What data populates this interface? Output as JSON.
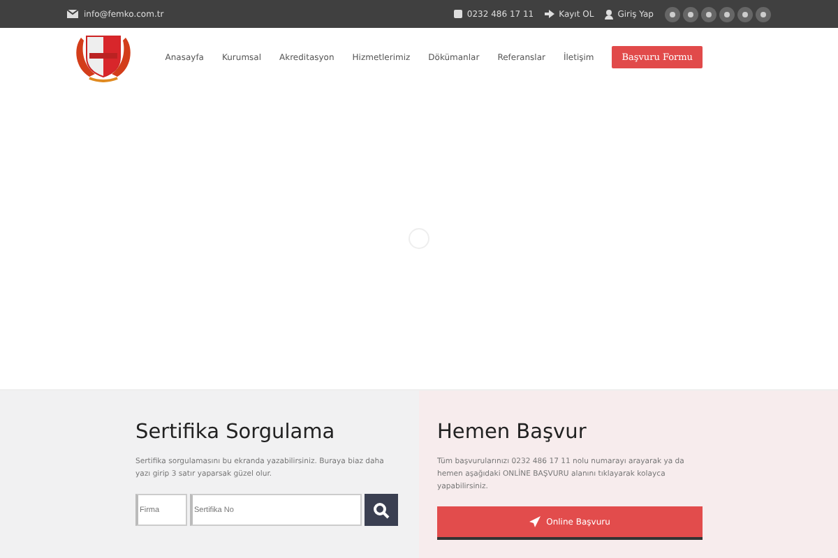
{
  "topbar": {
    "email": "info@femko.com.tr",
    "phone": "0232 486 17 11",
    "register": "Kayıt OL",
    "login": "Giriş Yap"
  },
  "nav": {
    "items": [
      {
        "label": "Anasayfa"
      },
      {
        "label": "Kurumsal"
      },
      {
        "label": "Akreditasyon"
      },
      {
        "label": "Hizmetlerimiz"
      },
      {
        "label": "Dökümanlar"
      },
      {
        "label": "Referanslar"
      },
      {
        "label": "İletişim"
      }
    ],
    "cta": "Başvuru Formu"
  },
  "certificate": {
    "title": "Sertifika Sorgulama",
    "text": "Sertifika sorgulamasını bu ekranda yazabilirsiniz. Buraya biaz daha yazı girip 3 satır yaparsak güzel olur.",
    "firm_placeholder": "Firma",
    "number_placeholder": "Sertifika No"
  },
  "apply": {
    "title": "Hemen Başvur",
    "text": "Tüm başvurularınızı 0232 486 17 11 nolu numarayı arayarak ya da hemen aşağıdaki ONLİNE BAŞVURU alanını tıklayarak kolayca yapabilirsiniz.",
    "button": "Online Başvuru"
  }
}
